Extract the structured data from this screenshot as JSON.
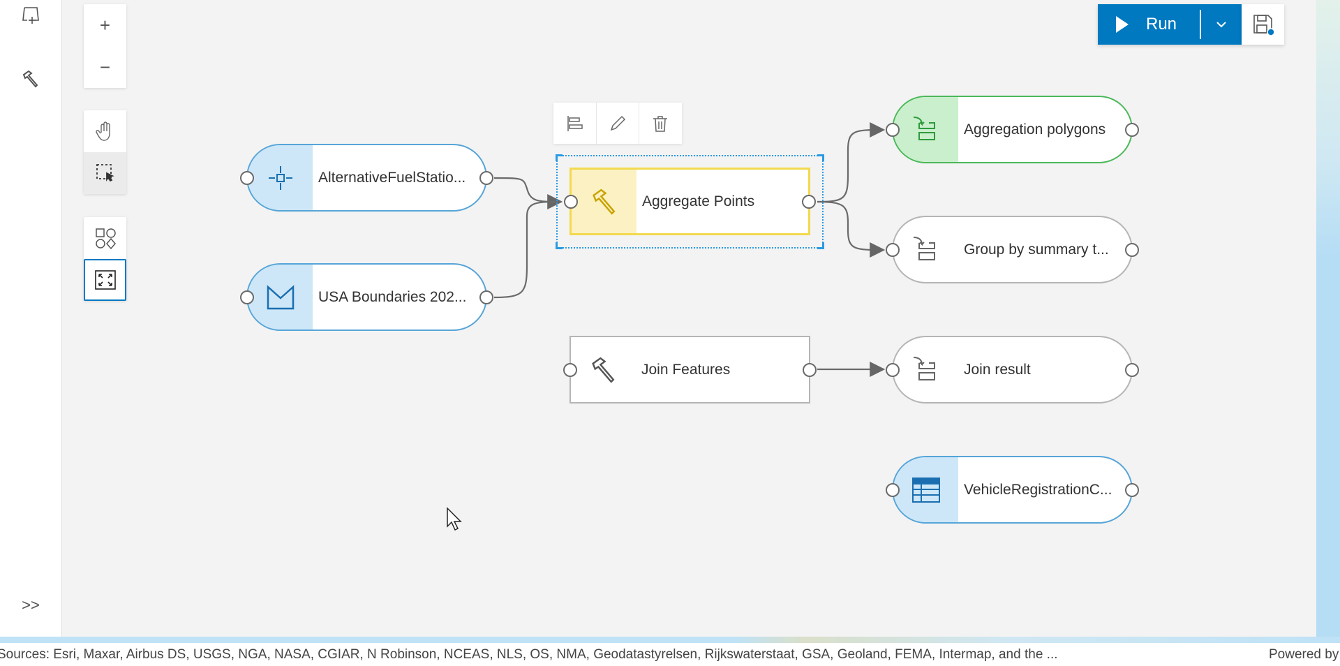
{
  "sidebar": {
    "items": [
      {
        "icon": "add-map-icon"
      },
      {
        "icon": "hammer-icon"
      }
    ],
    "expand_label": ">>"
  },
  "zoom_panel": {
    "zoom_in": "+",
    "zoom_out": "−"
  },
  "run_button": {
    "label": "Run",
    "dropdown": "chevron-down-icon",
    "save": "save-icon",
    "has_unsaved": true
  },
  "toolbar": {
    "items": [
      "align-icon",
      "edit-icon",
      "delete-icon"
    ]
  },
  "nodes": [
    {
      "id": "altfuel",
      "label": "AlternativeFuelStatio...",
      "kind": "input-points",
      "color": "#56a5d8",
      "fill": "#cde7f8"
    },
    {
      "id": "usa",
      "label": "USA Boundaries 202...",
      "kind": "input-polygons",
      "color": "#56a5d8",
      "fill": "#cde7f8"
    },
    {
      "id": "aggregate",
      "label": "Aggregate Points",
      "kind": "tool",
      "color": "#f2d94e",
      "fill": "#fbf1c2",
      "selected": true
    },
    {
      "id": "aggpoly",
      "label": "Aggregation polygons",
      "kind": "output",
      "color": "#4cb85a",
      "fill": "#c9efcc"
    },
    {
      "id": "groupby",
      "label": "Group by summary t...",
      "kind": "output",
      "color": "#b5b5b5",
      "fill": "#ffffff"
    },
    {
      "id": "join",
      "label": "Join Features",
      "kind": "tool",
      "color": "#b5b5b5",
      "fill": "#ffffff"
    },
    {
      "id": "joinresult",
      "label": "Join result",
      "kind": "output",
      "color": "#b5b5b5",
      "fill": "#ffffff"
    },
    {
      "id": "vehicle",
      "label": "VehicleRegistrationC...",
      "kind": "input-table",
      "color": "#56a5d8",
      "fill": "#cde7f8"
    }
  ],
  "edges": [
    [
      "altfuel",
      "aggregate"
    ],
    [
      "usa",
      "aggregate"
    ],
    [
      "aggregate",
      "aggpoly"
    ],
    [
      "aggregate",
      "groupby"
    ],
    [
      "join",
      "joinresult"
    ]
  ],
  "attribution": {
    "sources": "Sources: Esri, Maxar, Airbus DS, USGS, NGA, NASA, CGIAR, N Robinson, NCEAS, NLS, OS, NMA, Geodatastyrelsen, Rijkswaterstaat, GSA, Geoland, FEMA, Intermap, and the ...",
    "powered": "Powered by Esri"
  },
  "colors": {
    "accent": "#0079c1",
    "canvas": "#f3f3f3"
  }
}
